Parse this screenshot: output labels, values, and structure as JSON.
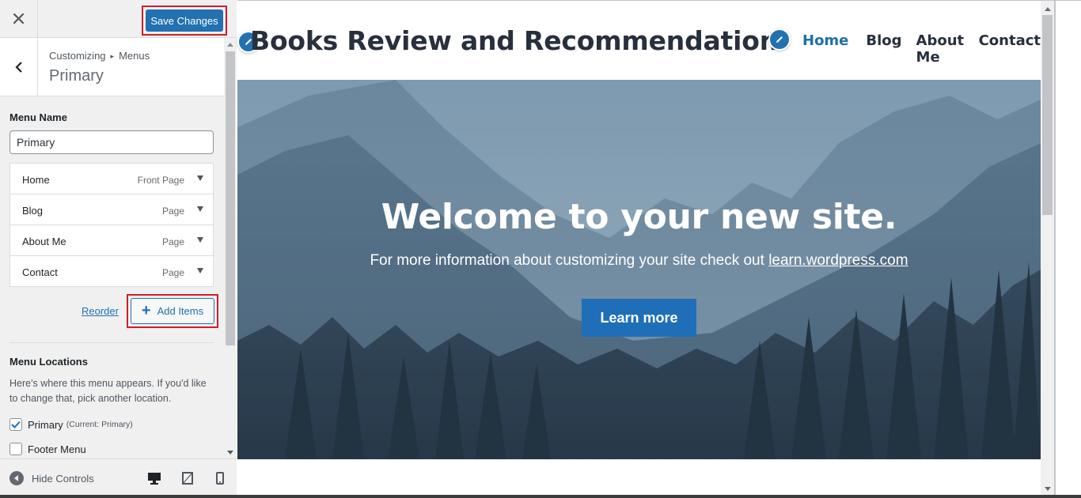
{
  "topbar": {
    "close_icon": "close-icon",
    "save_label": "Save Changes"
  },
  "panel": {
    "breadcrumb_parent": "Customizing",
    "breadcrumb_current": "Menus",
    "title": "Primary"
  },
  "menu_name": {
    "label": "Menu Name",
    "value": "Primary"
  },
  "menu_items": [
    {
      "label": "Home",
      "type": "Front Page"
    },
    {
      "label": "Blog",
      "type": "Page"
    },
    {
      "label": "About Me",
      "type": "Page"
    },
    {
      "label": "Contact",
      "type": "Page"
    }
  ],
  "actions": {
    "reorder_label": "Reorder",
    "add_items_label": "Add Items"
  },
  "locations": {
    "title": "Menu Locations",
    "description": "Here's where this menu appears. If you'd like to change that, pick another location.",
    "options": [
      {
        "label": "Primary",
        "note": "(Current: Primary)",
        "checked": true
      },
      {
        "label": "Footer Menu",
        "note": "",
        "checked": false
      }
    ]
  },
  "footer": {
    "hide_controls_label": "Hide Controls",
    "devices": [
      "desktop-icon",
      "tablet-icon",
      "mobile-icon"
    ],
    "active_device": "desktop"
  },
  "site": {
    "title": "Books Review and Recommendation",
    "nav": [
      {
        "label": "Home",
        "active": true
      },
      {
        "label": "Blog",
        "active": false
      },
      {
        "label": "About Me",
        "active": false
      },
      {
        "label": "Contact",
        "active": false
      }
    ]
  },
  "hero": {
    "title": "Welcome to your new site.",
    "subtitle_prefix": "For more information about customizing your site check out",
    "subtitle_link": "learn.wordpress.com",
    "button_label": "Learn more"
  },
  "colors": {
    "accent": "#2271b1",
    "highlight_border": "#d01d29",
    "nav_active": "#1f6fa8",
    "hero_button": "#1e6fb8"
  }
}
